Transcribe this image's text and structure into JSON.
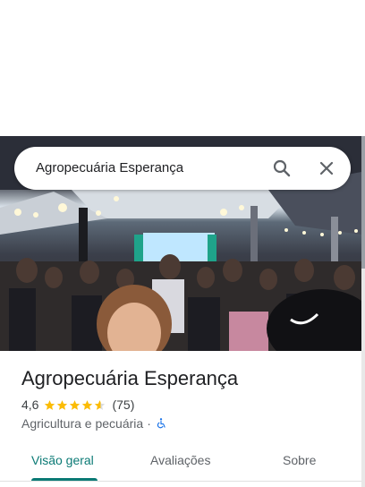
{
  "search": {
    "query": "Agropecuária Esperança"
  },
  "place": {
    "name": "Agropecuária Esperança",
    "rating": "4,6",
    "rating_stars": 4.6,
    "review_count": "(75)",
    "category": "Agricultura e pecuária",
    "separator": "·"
  },
  "tabs": [
    {
      "label": "Visão geral",
      "active": true
    },
    {
      "label": "Avaliações",
      "active": false
    },
    {
      "label": "Sobre",
      "active": false
    }
  ],
  "colors": {
    "star": "#fbbc04",
    "accent": "#0b7a75",
    "accessibility": "#1a73e8"
  },
  "icons": {
    "search": "search-icon",
    "close": "close-icon",
    "accessibility": "wheelchair-icon"
  }
}
